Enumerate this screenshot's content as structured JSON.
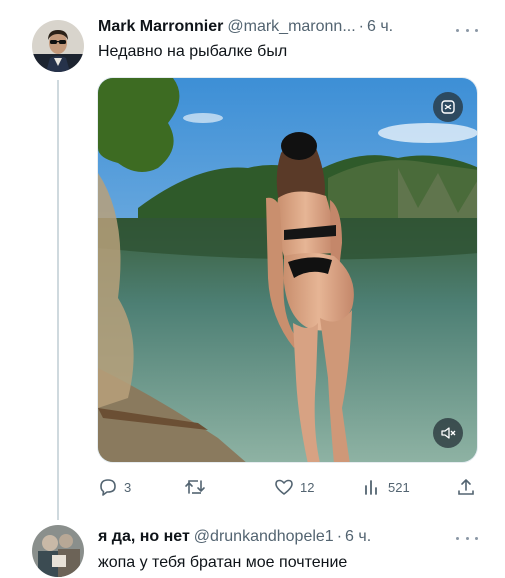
{
  "tweets": [
    {
      "display_name": "Mark Marronnier",
      "handle": "@mark_maronn...",
      "separator": "·",
      "time": "6 ч.",
      "text": "Недавно на рыбалке был",
      "media": {
        "badge_icon": "gif-badge-icon",
        "mute_icon": "muted-speaker-icon"
      },
      "actions": {
        "reply_count": "3",
        "retweet_count": "",
        "like_count": "12",
        "view_count": "521"
      }
    },
    {
      "display_name": "я да, но нет",
      "handle": "@drunkandhopele1",
      "separator": "·",
      "time": "6 ч.",
      "text": "жопа у тебя братан мое почтение"
    }
  ],
  "colors": {
    "text_primary": "#0f1419",
    "text_secondary": "#536471",
    "thread_line": "#cfd9de"
  }
}
